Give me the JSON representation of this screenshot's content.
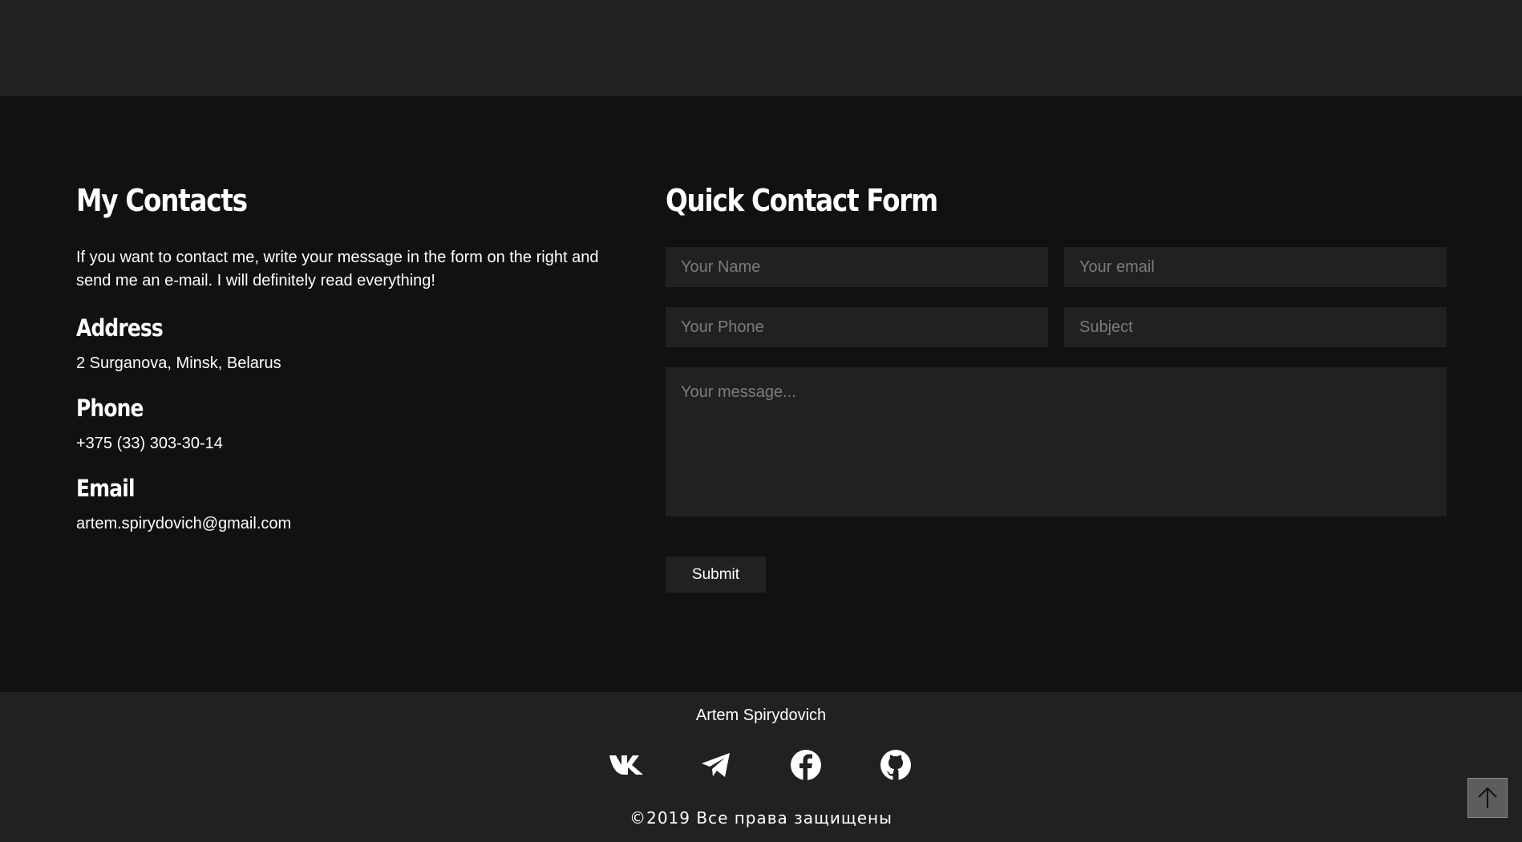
{
  "contacts": {
    "title": "My Contacts",
    "intro": "If you want to contact me, write your message in the form on the right and send me an e-mail. I will definitely read everything!",
    "address_heading": "Address",
    "address": "2 Surganova, Minsk, Belarus",
    "phone_heading": "Phone",
    "phone": "+375 (33) 303-30-14",
    "email_heading": "Email",
    "email": "artem.spirydovich@gmail.com"
  },
  "form": {
    "title": "Quick Contact Form",
    "name_placeholder": "Your Name",
    "email_placeholder": "Your email",
    "phone_placeholder": "Your Phone",
    "subject_placeholder": "Subject",
    "message_placeholder": "Your message...",
    "submit_label": "Submit"
  },
  "footer": {
    "name": "Artem Spirydovich",
    "social_icons": [
      "vk-icon",
      "telegram-icon",
      "facebook-icon",
      "github-icon"
    ],
    "copyright": "©2019 Все права защищены"
  },
  "colors": {
    "background": "#111111",
    "panel": "#212121",
    "placeholder": "#7c7c7c",
    "text": "#ffffff",
    "scroll_button": "#5d5d5d"
  }
}
